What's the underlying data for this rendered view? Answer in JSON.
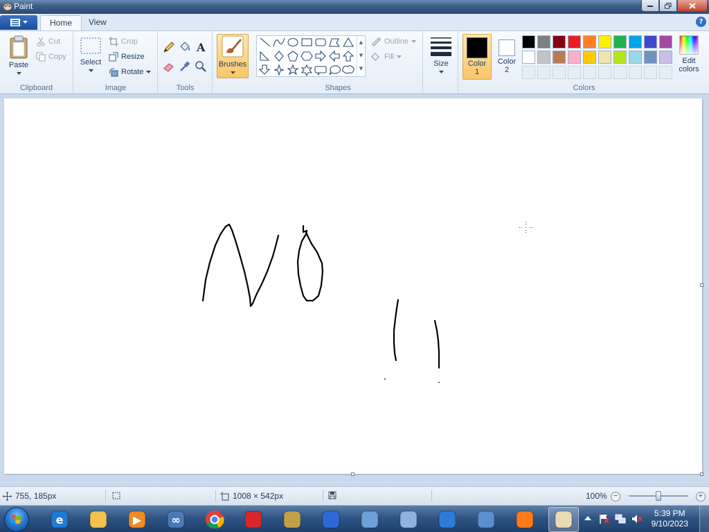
{
  "window": {
    "title": "Paint"
  },
  "tabs": [
    {
      "label": "Home",
      "active": true
    },
    {
      "label": "View",
      "active": false
    }
  ],
  "ribbon": {
    "clipboard": {
      "label": "Clipboard",
      "paste": "Paste",
      "cut": "Cut",
      "copy": "Copy"
    },
    "image": {
      "label": "Image",
      "select": "Select",
      "crop": "Crop",
      "resize": "Resize",
      "rotate": "Rotate"
    },
    "tools": {
      "label": "Tools",
      "items": [
        "pencil-icon",
        "fill-bucket-icon",
        "text-icon",
        "eraser-icon",
        "color-picker-icon",
        "magnifier-icon"
      ]
    },
    "brushes": {
      "label": "Brushes"
    },
    "shapes": {
      "label": "Shapes",
      "outline": "Outline",
      "fill": "Fill"
    },
    "size": {
      "label": "Size"
    },
    "colors": {
      "label": "Colors",
      "color1_label": "Color\n1",
      "color1_line1": "Color",
      "color1_line2": "1",
      "color2_line1": "Color",
      "color2_line2": "2",
      "color1_value": "#000000",
      "color2_value": "#ffffff",
      "edit_line1": "Edit",
      "edit_line2": "colors",
      "row1": [
        "#000000",
        "#7f7f7f",
        "#880015",
        "#ed1c24",
        "#ff7f27",
        "#fff200",
        "#22b14c",
        "#00a2e8",
        "#3f48cc",
        "#a349a4"
      ],
      "row2": [
        "#ffffff",
        "#c3c3c3",
        "#b97a57",
        "#ffaec9",
        "#ffc90e",
        "#efe4b0",
        "#b5e61d",
        "#99d9ea",
        "#7092be",
        "#c8bfe7"
      ]
    }
  },
  "status": {
    "cursor_position": "755, 185px",
    "canvas_size": "1008 × 542px",
    "zoom": "100%",
    "zoom_level_fraction": 0.5
  },
  "taskbar": {
    "apps": [
      "internet-explorer-icon",
      "file-explorer-icon",
      "media-player-icon",
      "infinity-app-icon",
      "chrome-icon",
      "red-app-icon",
      "game-app-icon",
      "paint-3d-blocks-icon",
      "network-computer-icon",
      "paint-brush-app-icon",
      "remote-desktop-icon",
      "computer-network-icon",
      "firefox-icon",
      "paint-icon"
    ],
    "time": "5:39 PM",
    "date": "9/10/2023"
  }
}
